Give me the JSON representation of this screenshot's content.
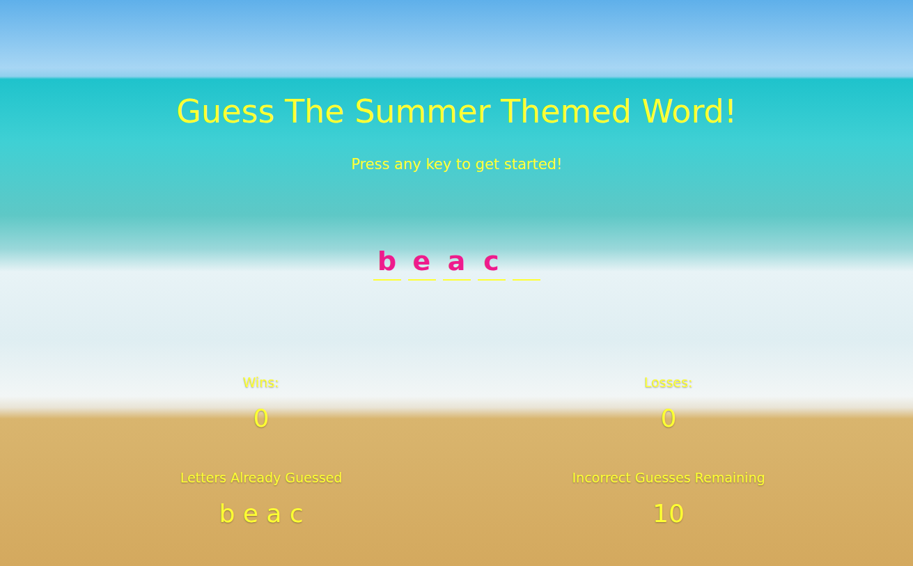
{
  "title": "Guess The Summer Themed Word!",
  "instructions": "Press any key to get started!",
  "word": [
    {
      "letter": "b"
    },
    {
      "letter": "e"
    },
    {
      "letter": "a"
    },
    {
      "letter": "c"
    },
    {
      "letter": ""
    }
  ],
  "wins": {
    "label": "Wins:",
    "value": "0"
  },
  "losses": {
    "label": "Losses:",
    "value": "0"
  },
  "guessed": {
    "label": "Letters Already Guessed",
    "value": "b e a c"
  },
  "remaining": {
    "label": "Incorrect Guesses Remaining",
    "value": "10"
  }
}
